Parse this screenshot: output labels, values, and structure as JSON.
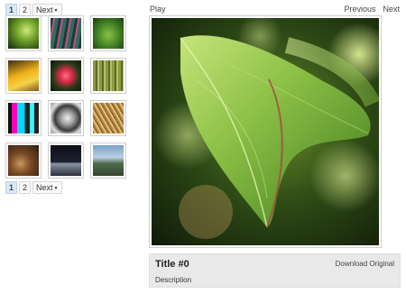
{
  "pager": {
    "pages": [
      "1",
      "2"
    ],
    "current_page": "1",
    "next_label": "Next"
  },
  "thumbnails": [
    {
      "subject": "green leaf"
    },
    {
      "subject": "green and pink stripes"
    },
    {
      "subject": "heart-shaped leaf"
    },
    {
      "subject": "yellow bananas"
    },
    {
      "subject": "red flower"
    },
    {
      "subject": "bamboo stalks"
    },
    {
      "subject": "colorful stripes"
    },
    {
      "subject": "camera lens"
    },
    {
      "subject": "golden curves"
    },
    {
      "subject": "rope knot"
    },
    {
      "subject": "night city"
    },
    {
      "subject": "coastal landscape"
    }
  ],
  "slideshow": {
    "play_label": "Play",
    "previous_label": "Previous",
    "next_label": "Next"
  },
  "caption": {
    "title": "Title #0",
    "description": "Description",
    "download_label": "Download Original"
  },
  "colors": {
    "page_current_bg": "#dde8f3",
    "caption_bg": "#e9e9e9",
    "frame_border": "#cfcfcf"
  }
}
